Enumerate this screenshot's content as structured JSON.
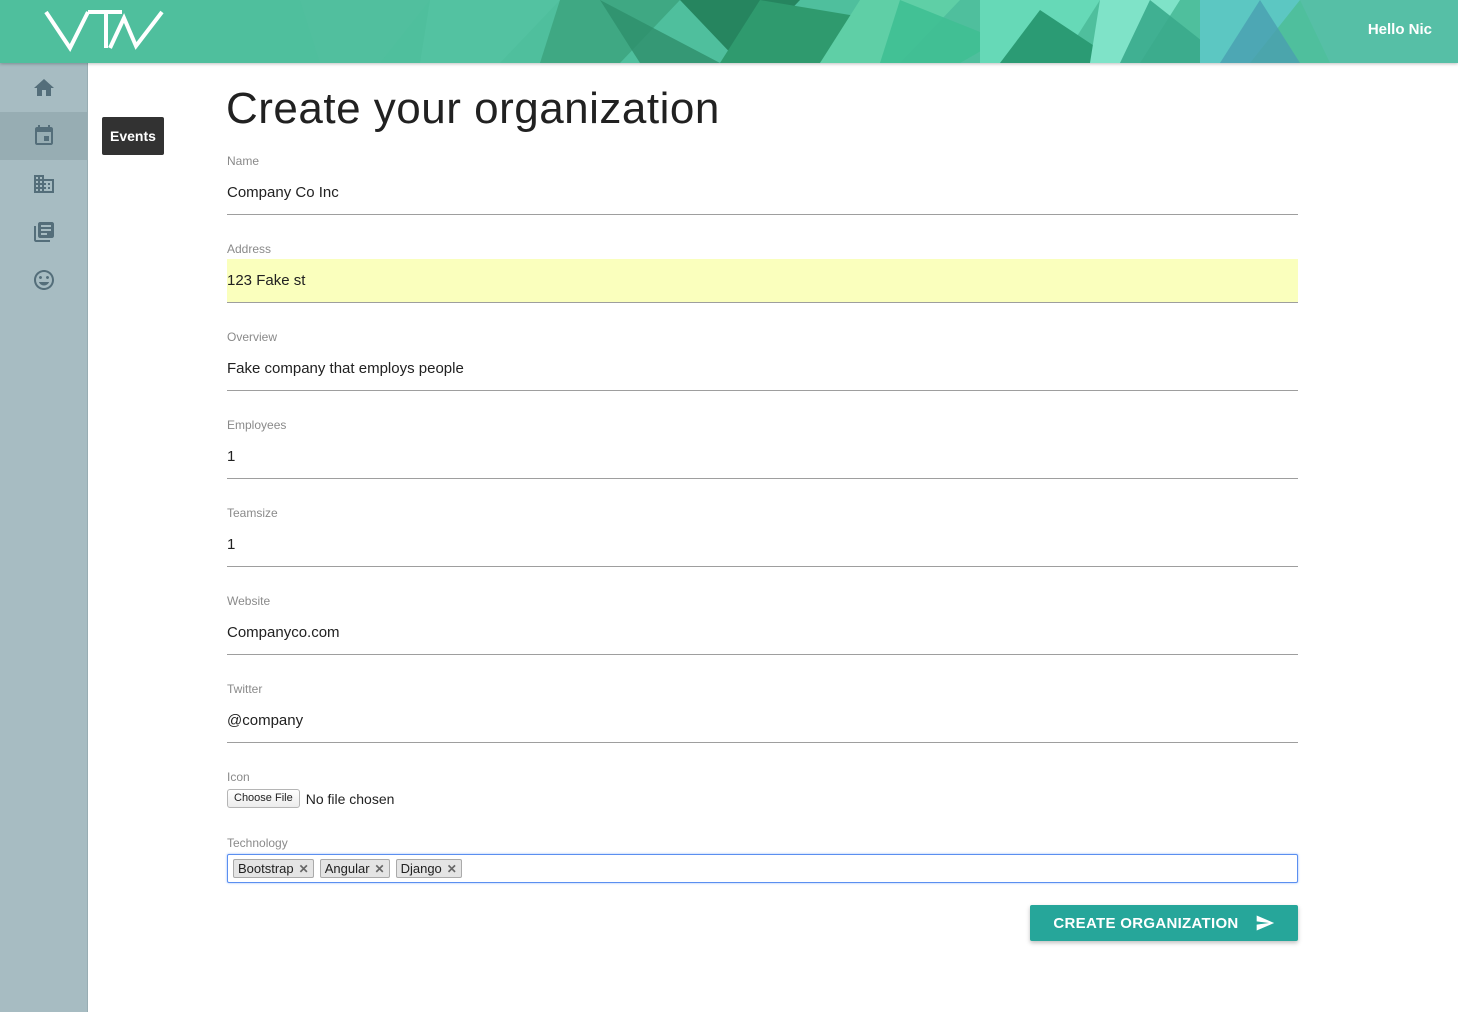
{
  "header": {
    "greeting": "Hello Nic",
    "logo_icon": "tiw-logo-icon",
    "colors": {
      "primary": "#4fbf9d",
      "dark": "#2e8a6c",
      "light": "#7ee0c6"
    }
  },
  "sidebar": {
    "items": [
      {
        "icon": "home-icon"
      },
      {
        "icon": "event-icon",
        "active": true
      },
      {
        "icon": "business-icon"
      },
      {
        "icon": "library-books-icon"
      },
      {
        "icon": "smiley-icon"
      }
    ],
    "tooltip": "Events"
  },
  "page": {
    "title": "Create your organization"
  },
  "form": {
    "name": {
      "label": "Name",
      "value": "Company Co Inc"
    },
    "address": {
      "label": "Address",
      "value": "123 Fake st"
    },
    "overview": {
      "label": "Overview",
      "value": "Fake company that employs people"
    },
    "employees": {
      "label": "Employees",
      "value": "1"
    },
    "teamsize": {
      "label": "Teamsize",
      "value": "1"
    },
    "website": {
      "label": "Website",
      "value": "Companyco.com"
    },
    "twitter": {
      "label": "Twitter",
      "value": "@company"
    },
    "icon": {
      "label": "Icon",
      "button": "Choose File",
      "status": "No file chosen"
    },
    "technology": {
      "label": "Technology",
      "tags": [
        "Bootstrap",
        "Angular",
        "Django"
      ],
      "remove_symbol": "✕"
    },
    "submit": {
      "label": "CREATE ORGANIZATION",
      "icon": "send-icon",
      "color": "#26a69a"
    }
  }
}
